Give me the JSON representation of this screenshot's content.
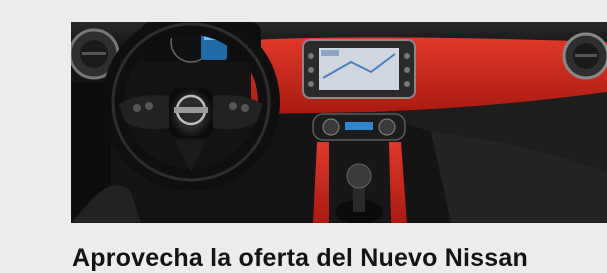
{
  "promo": {
    "image_alt": "Nissan Micra interior dashboard with red trim",
    "logo_icon": "nissan-logo-icon",
    "headline": "Aprovecha la oferta del Nuevo Nissan"
  },
  "colors": {
    "background": "#ececec",
    "accent_red": "#d8271c",
    "dashboard_dark": "#151515"
  }
}
